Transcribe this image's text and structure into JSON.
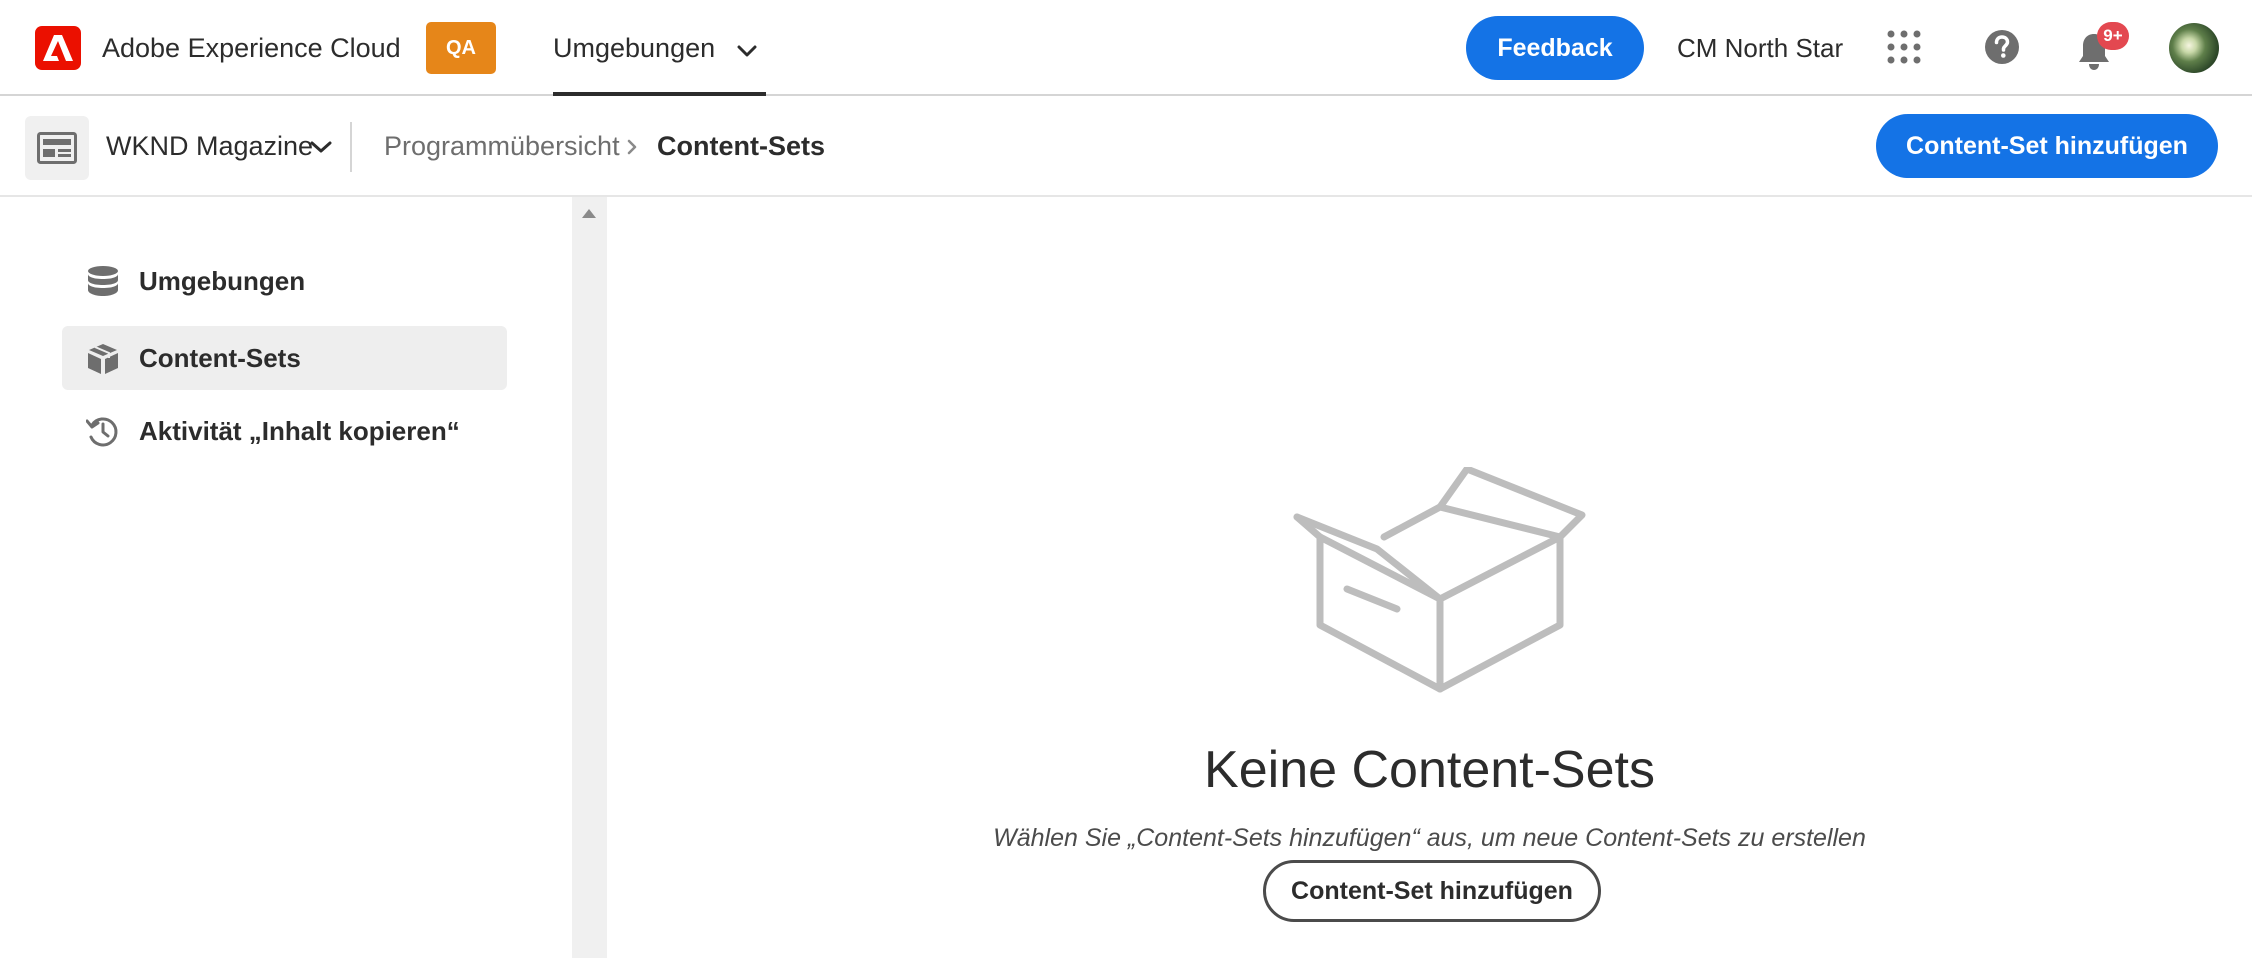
{
  "header": {
    "app_title": "Adobe Experience Cloud",
    "env_badge": "QA",
    "nav_tab": "Umgebungen",
    "feedback_label": "Feedback",
    "org_name": "CM North Star",
    "notification_count": "9+"
  },
  "subheader": {
    "program_name": "WKND Magazine",
    "breadcrumbs": [
      "Programmübersicht",
      "Content-Sets"
    ],
    "add_button_label": "Content-Set hinzufügen"
  },
  "sidebar": {
    "items": [
      {
        "label": "Umgebungen",
        "icon": "database-icon",
        "active": false
      },
      {
        "label": "Content-Sets",
        "icon": "box-icon",
        "active": true
      },
      {
        "label": "Aktivität „Inhalt kopieren“",
        "icon": "history-icon",
        "active": false
      }
    ]
  },
  "empty_state": {
    "title": "Keine Content-Sets",
    "description": "Wählen Sie „Content-Sets hinzufügen“ aus, um neue Content-Sets zu erstellen",
    "button_label": "Content-Set hinzufügen"
  },
  "colors": {
    "accent": "#1473e6",
    "adobe_red": "#eb1000",
    "env_badge": "#e68619",
    "notification": "#e34850"
  }
}
